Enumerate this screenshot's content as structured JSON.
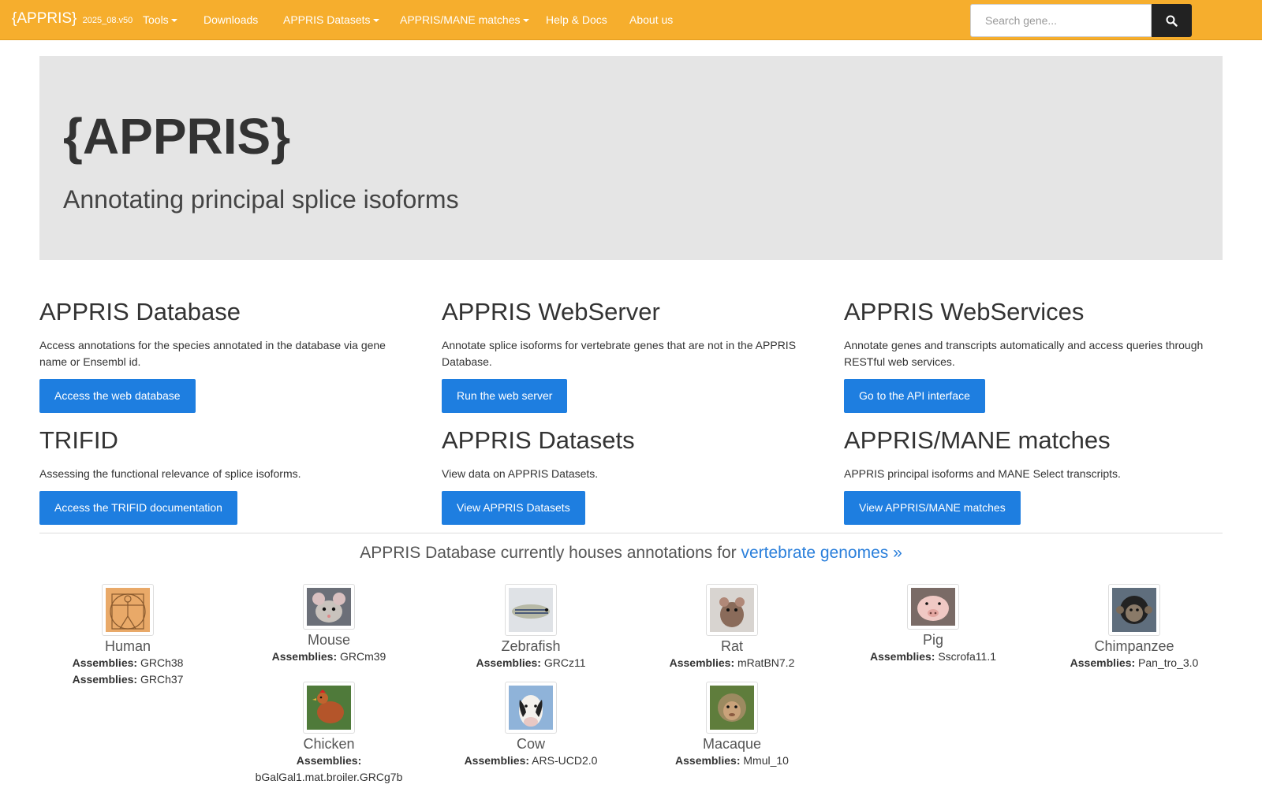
{
  "navbar": {
    "brand": "{APPRIS}",
    "version": "2025_08.v50",
    "items": [
      {
        "label": "Tools",
        "dropdown": true
      },
      {
        "label": "Downloads",
        "dropdown": false
      },
      {
        "label": "APPRIS Datasets",
        "dropdown": true
      },
      {
        "label": "APPRIS/MANE matches",
        "dropdown": true
      },
      {
        "label": "Help & Docs",
        "dropdown": false
      },
      {
        "label": "About us",
        "dropdown": false
      }
    ],
    "search_placeholder": "Search gene...",
    "search_icon": "search-icon"
  },
  "jumbotron": {
    "title": "{APPRIS}",
    "subtitle": "Annotating principal splice isoforms"
  },
  "cards": [
    {
      "title": "APPRIS Database",
      "text": "Access annotations for the species annotated in the database via gene name or Ensembl id.",
      "button": "Access the web database"
    },
    {
      "title": "APPRIS WebServer",
      "text": "Annotate splice isoforms for vertebrate genes that are not in the APPRIS Database.",
      "button": "Run the web server"
    },
    {
      "title": "APPRIS WebServices",
      "text": "Annotate genes and transcripts automatically and access queries through RESTful web services.",
      "button": "Go to the API interface"
    },
    {
      "title": "TRIFID",
      "text": "Assessing the functional relevance of splice isoforms.",
      "button": "Access the TRIFID documentation"
    },
    {
      "title": "APPRIS Datasets",
      "text": "View data on APPRIS Datasets.",
      "button": "View APPRIS Datasets"
    },
    {
      "title": "APPRIS/MANE matches",
      "text": "APPRIS principal isoforms and MANE Select transcripts.",
      "button": "View APPRIS/MANE matches"
    }
  ],
  "species_section": {
    "heading": "APPRIS Database currently houses annotations for",
    "link": "vertebrate genomes »"
  },
  "assemblies_label": "Assemblies:",
  "species": [
    {
      "name": "Human",
      "assemblies": [
        "GRCh38",
        "GRCh37"
      ],
      "icon": "vitruvian-man-thumbnail"
    },
    {
      "name": "Mouse",
      "assemblies": [
        "GRCm39"
      ],
      "icon": "mouse-thumbnail"
    },
    {
      "name": "Zebrafish",
      "assemblies": [
        "GRCz11"
      ],
      "icon": "zebrafish-thumbnail"
    },
    {
      "name": "Rat",
      "assemblies": [
        "mRatBN7.2"
      ],
      "icon": "rat-thumbnail"
    },
    {
      "name": "Pig",
      "assemblies": [
        "Sscrofa11.1"
      ],
      "icon": "pig-thumbnail"
    },
    {
      "name": "Chimpanzee",
      "assemblies": [
        "Pan_tro_3.0"
      ],
      "icon": "chimpanzee-thumbnail"
    },
    {
      "name": "Chicken",
      "assemblies": [
        "bGalGal1.mat.broiler.GRCg7b"
      ],
      "icon": "chicken-thumbnail"
    },
    {
      "name": "Cow",
      "assemblies": [
        "ARS-UCD2.0"
      ],
      "icon": "cow-thumbnail"
    },
    {
      "name": "Macaque",
      "assemblies": [
        "Mmul_10"
      ],
      "icon": "macaque-thumbnail"
    }
  ],
  "colors": {
    "navbar": "#f6ae2d",
    "button": "#1e7ee0",
    "link": "#2a7fdb",
    "jumbotron": "#e5e5e5"
  }
}
